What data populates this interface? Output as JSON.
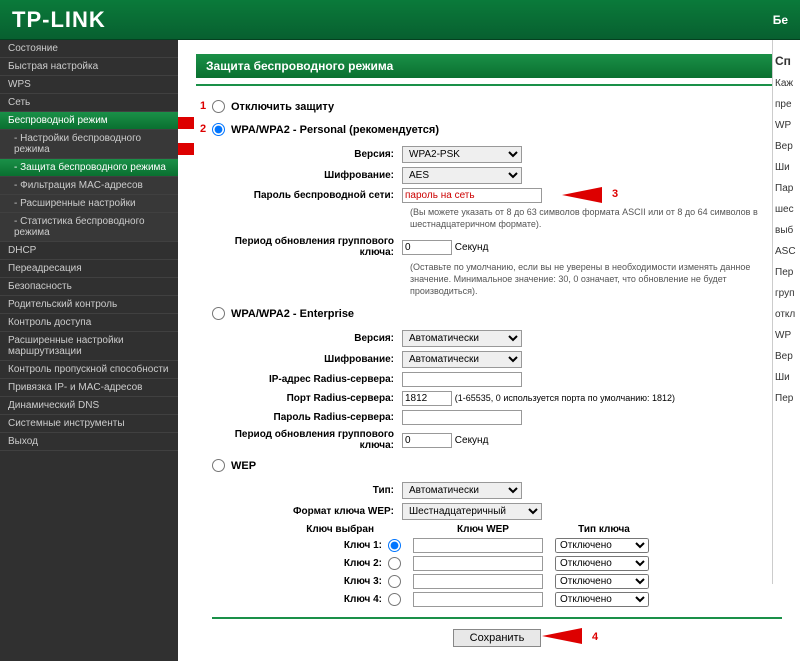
{
  "header": {
    "logo": "TP-LINK",
    "right": "Бе"
  },
  "sidebar": {
    "items": [
      {
        "label": "Состояние"
      },
      {
        "label": "Быстрая настройка"
      },
      {
        "label": "WPS"
      },
      {
        "label": "Сеть"
      },
      {
        "label": "Беспроводной режим",
        "active": true
      },
      {
        "label": "- Настройки беспроводного режима",
        "sub": true
      },
      {
        "label": "- Защита беспроводного режима",
        "sub": true,
        "activeSub": true
      },
      {
        "label": "- Фильтрация MAC-адресов",
        "sub": true
      },
      {
        "label": "- Расширенные настройки",
        "sub": true
      },
      {
        "label": "- Статистика беспроводного режима",
        "sub": true
      },
      {
        "label": "DHCP"
      },
      {
        "label": "Переадресация"
      },
      {
        "label": "Безопасность"
      },
      {
        "label": "Родительский контроль"
      },
      {
        "label": "Контроль доступа"
      },
      {
        "label": "Расширенные настройки маршрутизации"
      },
      {
        "label": "Контроль пропускной способности"
      },
      {
        "label": "Привязка IP- и MAC-адресов"
      },
      {
        "label": "Динамический DNS"
      },
      {
        "label": "Системные инструменты"
      },
      {
        "label": "Выход"
      }
    ]
  },
  "page": {
    "title": "Защита беспроводного режима"
  },
  "security": {
    "disable_label": "Отключить защиту",
    "personal_label": "WPA/WPA2 - Personal (рекомендуется)",
    "version_label": "Версия:",
    "version_value": "WPA2-PSK",
    "encryption_label": "Шифрование:",
    "encryption_value": "AES",
    "password_label": "Пароль беспроводной сети:",
    "password_value": "пароль на сеть",
    "password_note": "(Вы можете указать от 8 до 63 символов формата ASCII или от 8 до 64 символов в шестнадцатеричном формате).",
    "gk_label": "Период обновления группового ключа:",
    "gk_value": "0",
    "gk_unit": "Секунд",
    "gk_note": "(Оставьте по умолчанию, если вы не уверены в необходимости изменять данное значение. Минимальное значение: 30, 0 означает, что обновление не будет производиться).",
    "enterprise_label": "WPA/WPA2 - Enterprise",
    "ent_version": "Автоматически",
    "ent_encryption": "Автоматически",
    "radius_ip_label": "IP-адрес Radius-сервера:",
    "radius_port_label": "Порт Radius-сервера:",
    "radius_port_value": "1812",
    "radius_port_note": "(1-65535, 0 используется порта по умолчанию: 1812)",
    "radius_pwd_label": "Пароль Radius-сервера:",
    "ent_gk_value": "0",
    "wep_label": "WEP",
    "wep_type_label": "Тип:",
    "wep_type_value": "Автоматически",
    "wep_format_label": "Формат ключа WEP:",
    "wep_format_value": "Шестнадцатеричный",
    "wep_selected_label": "Ключ выбран",
    "wep_col_key": "Ключ WEP",
    "wep_col_type": "Тип ключа",
    "wep_key1": "Ключ 1:",
    "wep_key2": "Ключ 2:",
    "wep_key3": "Ключ 3:",
    "wep_key4": "Ключ 4:",
    "wep_disabled": "Отключено"
  },
  "buttons": {
    "save": "Сохранить"
  },
  "annotations": {
    "n1": "1",
    "n2": "2",
    "n3": "3",
    "n4": "4"
  },
  "right": {
    "hd": "Сп",
    "t1": "Каж",
    "t2": "пре",
    "t3": "WP",
    "t4": "Вер",
    "t5": "Ши",
    "t6": "Пар",
    "t7": "шес",
    "t8": "выб",
    "t9": "ASC",
    "t10": "Пер",
    "t11": "груп",
    "t12": "откл",
    "t13": "WP",
    "t14": "Вер",
    "t15": "Ши",
    "t16": "Пер"
  }
}
